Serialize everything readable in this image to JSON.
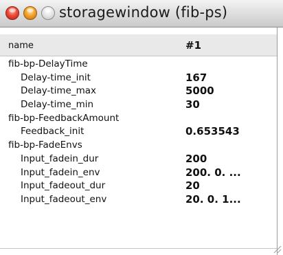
{
  "window": {
    "title": "storagewindow (fib-ps)"
  },
  "table": {
    "header": {
      "name_col": "name",
      "slot_col": "#1"
    },
    "rows": [
      {
        "type": "group",
        "name": "fib-bp-DelayTime",
        "value": ""
      },
      {
        "type": "param",
        "name": "Delay-time_init",
        "value": "167"
      },
      {
        "type": "param",
        "name": "Delay-time_max",
        "value": "5000"
      },
      {
        "type": "param",
        "name": "Delay-time_min",
        "value": "30"
      },
      {
        "type": "group",
        "name": "fib-bp-FeedbackAmount",
        "value": ""
      },
      {
        "type": "param",
        "name": "Feedback_init",
        "value": "0.653543"
      },
      {
        "type": "group",
        "name": "fib-bp-FadeEnvs",
        "value": ""
      },
      {
        "type": "param",
        "name": "Input_fadein_dur",
        "value": "200"
      },
      {
        "type": "param",
        "name": "Input_fadein_env",
        "value": "200. 0. ..."
      },
      {
        "type": "param",
        "name": "Input_fadeout_dur",
        "value": "20"
      },
      {
        "type": "param",
        "name": "Input_fadeout_env",
        "value": "20. 0. 1..."
      }
    ]
  },
  "colors": {
    "close_button": "#ef4a37",
    "minimize_button": "#f3a32d",
    "zoom_button": "#e4e4e4",
    "header_bg": "#e9e9e9"
  },
  "icons": {
    "close": "close-button-icon",
    "minimize": "minimize-button-icon",
    "zoom": "zoom-button-icon",
    "resize": "resize-grip-icon"
  }
}
